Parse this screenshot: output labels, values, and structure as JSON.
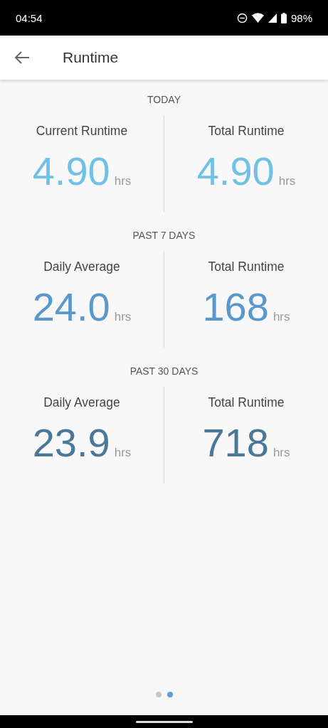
{
  "status_bar": {
    "time": "04:54",
    "battery": "98%"
  },
  "app_bar": {
    "title": "Runtime"
  },
  "sections": [
    {
      "heading": "TODAY",
      "color": "#70c0e8",
      "stats": [
        {
          "label": "Current Runtime",
          "value": "4.90",
          "unit": "hrs"
        },
        {
          "label": "Total Runtime",
          "value": "4.90",
          "unit": "hrs"
        }
      ]
    },
    {
      "heading": "PAST 7 DAYS",
      "color": "#5898cc",
      "stats": [
        {
          "label": "Daily Average",
          "value": "24.0",
          "unit": "hrs"
        },
        {
          "label": "Total Runtime",
          "value": "168",
          "unit": "hrs"
        }
      ]
    },
    {
      "heading": "PAST 30 DAYS",
      "color": "#4a7898",
      "stats": [
        {
          "label": "Daily Average",
          "value": "23.9",
          "unit": "hrs"
        },
        {
          "label": "Total Runtime",
          "value": "718",
          "unit": "hrs"
        }
      ]
    }
  ],
  "pager": [
    {
      "selected": false
    },
    {
      "selected": true
    }
  ]
}
